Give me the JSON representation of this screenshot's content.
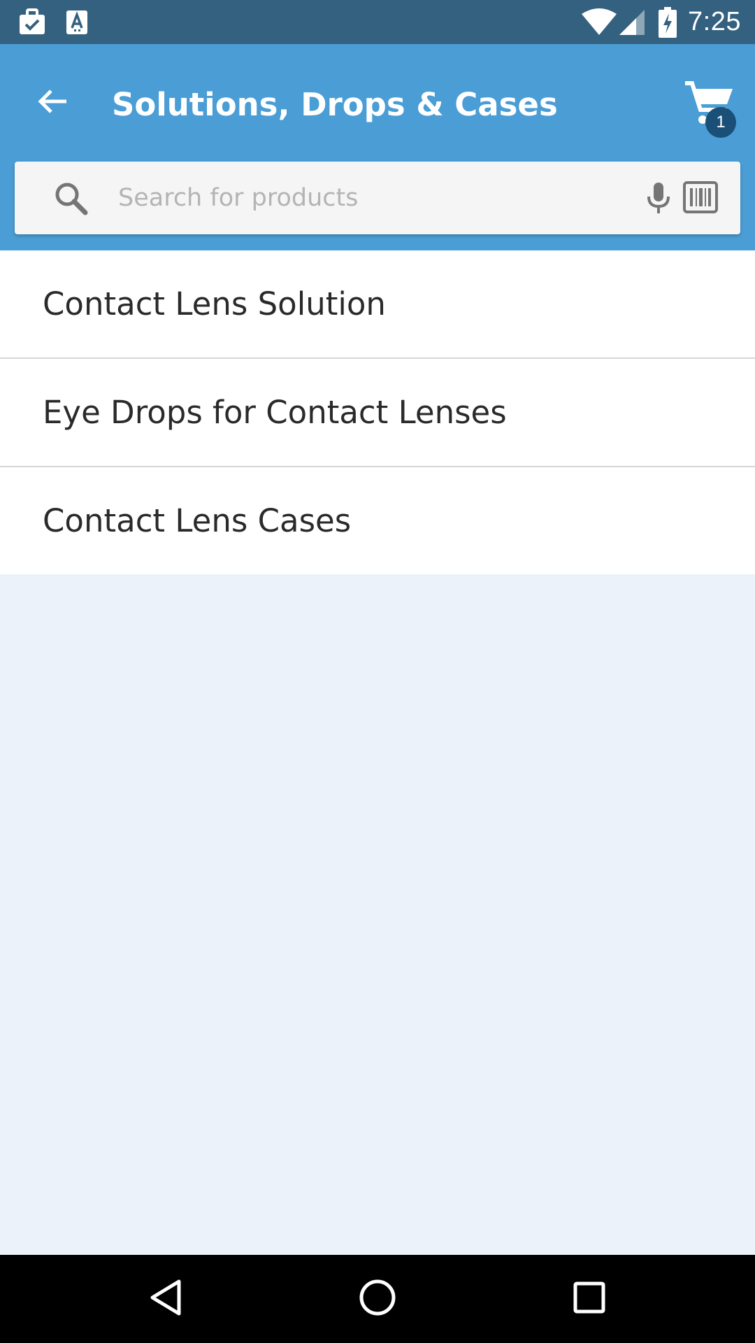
{
  "status_bar": {
    "time": "7:25",
    "icons": [
      "briefcase-check-icon",
      "text-a-icon",
      "wifi-icon",
      "cellular-signal-icon",
      "battery-charging-icon"
    ]
  },
  "app_bar": {
    "title": "Solutions, Drops & Cases",
    "back_icon": "arrow-back-icon",
    "cart_icon": "shopping-cart-icon",
    "cart_count": "1"
  },
  "search": {
    "placeholder": "Search for products",
    "value": "",
    "icons": [
      "search-icon",
      "microphone-icon",
      "barcode-icon"
    ]
  },
  "categories": [
    {
      "label": "Contact Lens Solution"
    },
    {
      "label": "Eye Drops for Contact Lenses"
    },
    {
      "label": "Contact Lens Cases"
    }
  ],
  "nav_bar": {
    "icons": [
      "back-triangle-icon",
      "home-circle-icon",
      "recents-square-icon"
    ]
  },
  "colors": {
    "status_bar": "#34617f",
    "app_bar": "#4a9dd5",
    "background": "#ebf2fa",
    "badge": "#1a4f78"
  }
}
